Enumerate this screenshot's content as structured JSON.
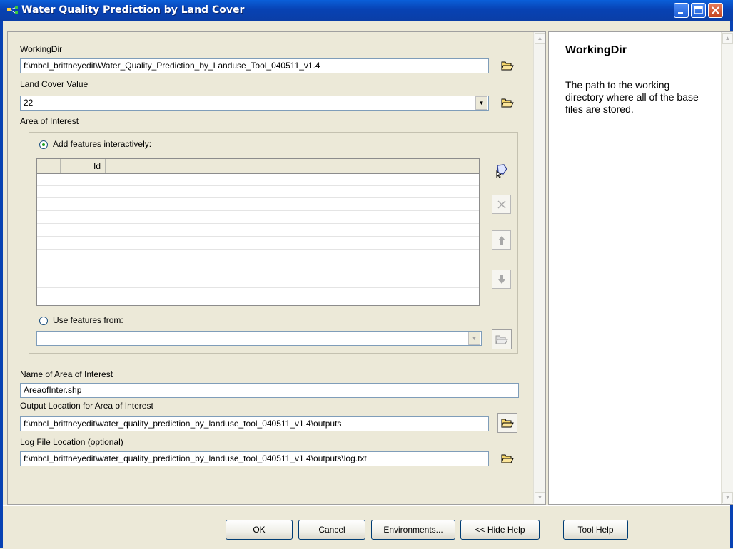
{
  "window": {
    "title": "Water Quality Prediction by Land Cover",
    "app_icon": "model-tool-icon",
    "controls": [
      "minimize-icon",
      "maximize-icon",
      "close-icon"
    ]
  },
  "params": {
    "working_dir": {
      "label": "WorkingDir",
      "value": "f:\\mbcl_brittneyedit\\Water_Quality_Prediction_by_Landuse_Tool_040511_v1.4"
    },
    "land_cover": {
      "label": "Land Cover Value",
      "value": "22"
    },
    "area_of_interest": {
      "label": "Area of Interest",
      "add_features_label": "Add features interactively:",
      "add_features_selected": true,
      "table_columns": [
        "",
        "Id",
        ""
      ],
      "table_rows": 9,
      "use_features_label": "Use features from:",
      "use_features_value": ""
    },
    "aoi_name": {
      "label": "Name of Area of Interest",
      "value": "AreaofInter.shp"
    },
    "output_location": {
      "label": "Output Location for Area of Interest",
      "value": "f:\\mbcl_brittneyedit\\water_quality_prediction_by_landuse_tool_040511_v1.4\\outputs"
    },
    "log_file": {
      "label": "Log File Location (optional)",
      "value": "f:\\mbcl_brittneyedit\\water_quality_prediction_by_landuse_tool_040511_v1.4\\outputs\\log.txt"
    }
  },
  "help": {
    "title": "WorkingDir",
    "body": "The path to the working directory where all of the base files are stored."
  },
  "buttons": {
    "ok": "OK",
    "cancel": "Cancel",
    "environments": "Environments...",
    "hide_help": "<< Hide Help",
    "tool_help": "Tool Help"
  },
  "colors": {
    "titlebar": "#0a4fcf",
    "window_bg": "#ece9d8",
    "textbox_border": "#7f9db9"
  }
}
